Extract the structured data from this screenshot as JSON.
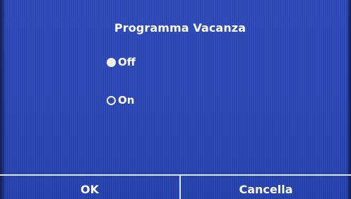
{
  "dialog": {
    "title": "Programma Vacanza",
    "options": [
      {
        "label": "Off",
        "selected": true
      },
      {
        "label": "On",
        "selected": false
      }
    ]
  },
  "buttons": {
    "ok_label": "OK",
    "cancel_label": "Cancella"
  },
  "colors": {
    "background": "#2946b4",
    "text": "#ffffff",
    "selected_radio": "#f1efe6",
    "divider": "#dfe5f4"
  }
}
